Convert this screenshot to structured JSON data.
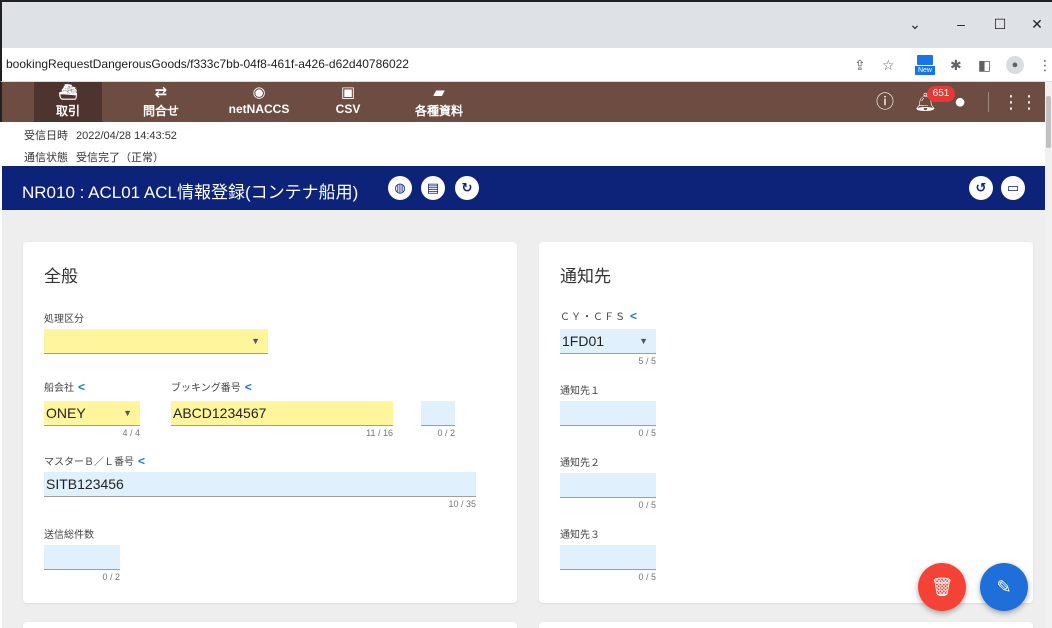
{
  "browser": {
    "url": "bookingRequestDangerousGoods/f333c7bb-04f8-461f-a426-d62d40786022",
    "new_badge": "New",
    "window_controls": [
      "⌄",
      "–",
      "☐",
      "✕"
    ]
  },
  "nav": {
    "items": [
      {
        "label": "取引",
        "icon": "ship-icon"
      },
      {
        "label": "問合せ",
        "icon": "swap-icon"
      },
      {
        "label": "netNACCS",
        "icon": "globe-icon"
      },
      {
        "label": "CSV",
        "icon": "file-icon"
      },
      {
        "label": "各種資料",
        "icon": "folder-icon"
      }
    ],
    "notification_count": "651"
  },
  "status": {
    "received_label": "受信日時",
    "received_value": "2022/04/28 14:43:52",
    "comm_label": "通信状態",
    "comm_value": "受信完了（正常）"
  },
  "page": {
    "title": "NR010 : ACL01 ACL情報登録(コンテナ船用)"
  },
  "general": {
    "title": "全般",
    "processing_label": "処理区分",
    "processing_value": "",
    "carrier_label": "船会社",
    "carrier_value": "ONEY",
    "carrier_counter": "4 / 4",
    "booking_label": "ブッキング番号",
    "booking_value": "ABCD1234567",
    "booking_counter": "11 / 16",
    "extra_value": "",
    "extra_counter": "0 / 2",
    "master_bl_label": "マスターＢ／Ｌ番号",
    "master_bl_value": "SITB123456",
    "master_bl_counter": "10 / 35",
    "total_label": "送信総件数",
    "total_value": "",
    "total_counter": "0 / 2"
  },
  "notify": {
    "title": "通知先",
    "cyfs_label": "ＣＹ・ＣＦＳ",
    "cyfs_value": "1FD01",
    "cyfs_counter": "5 / 5",
    "n1_label": "通知先１",
    "n1_value": "",
    "n1_counter": "0 / 5",
    "n2_label": "通知先２",
    "n2_value": "",
    "n2_counter": "0 / 5",
    "n3_label": "通知先３",
    "n3_value": "",
    "n3_counter": "0 / 5"
  },
  "colors": {
    "header_brown": "#6d4c41",
    "title_navy": "#0d237a",
    "field_yellow": "#fff59d",
    "field_blue": "#e1f0fd",
    "delete_red": "#f44336",
    "edit_blue": "#1e6fd9"
  }
}
